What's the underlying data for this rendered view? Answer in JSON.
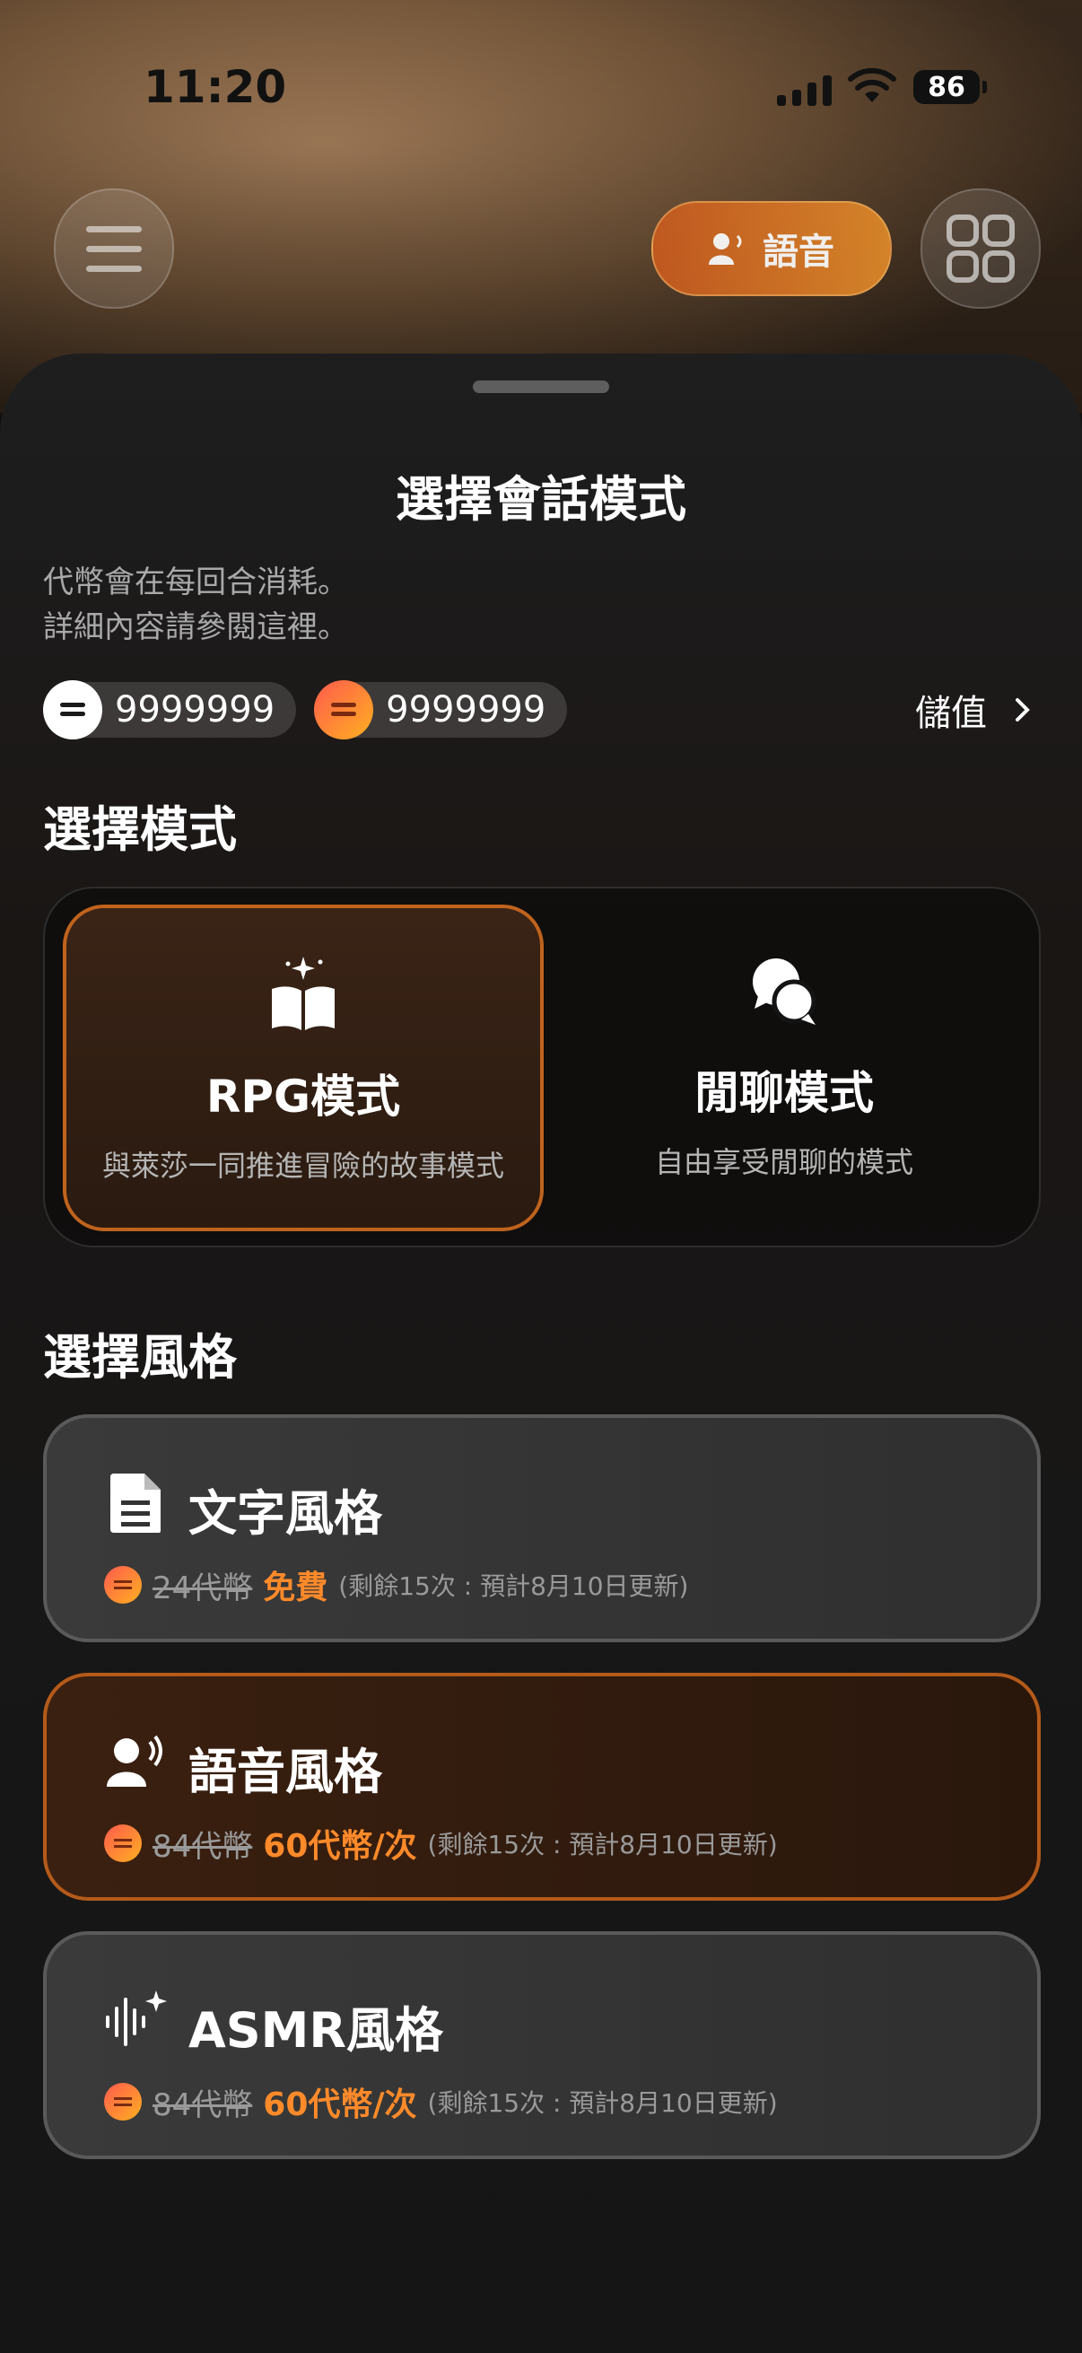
{
  "status_bar": {
    "time": "11:20",
    "battery": "86"
  },
  "top_bar": {
    "voice_label": "語音"
  },
  "sheet": {
    "title": "選擇會話模式",
    "desc_line1": "代幣會在每回合消耗。",
    "desc_line2": "詳細內容請參閱這裡。",
    "coin_white": "9999999",
    "coin_orange": "9999999",
    "topup_label": "儲值",
    "mode_section": "選擇模式",
    "modes": [
      {
        "name": "RPG模式",
        "sub": "與萊莎一同推進冒險的故事模式"
      },
      {
        "name": "閒聊模式",
        "sub": "自由享受閒聊的模式"
      }
    ],
    "style_section": "選擇風格",
    "styles": [
      {
        "name": "文字風格",
        "old": "24代幣",
        "new": "免費",
        "note": "(剩餘15次 : 預計8月10日更新)"
      },
      {
        "name": "語音風格",
        "old": "84代幣",
        "new": "60代幣/次",
        "note": "(剩餘15次 : 預計8月10日更新)"
      },
      {
        "name": "ASMR風格",
        "old": "84代幣",
        "new": "60代幣/次",
        "note": "(剩餘15次 : 預計8月10日更新)"
      }
    ]
  },
  "colors": {
    "accent": "#ff8a2a",
    "selected_border": "#c0631d"
  }
}
